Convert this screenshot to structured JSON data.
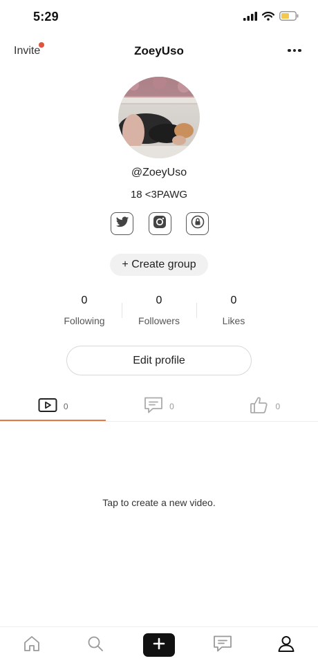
{
  "status_bar": {
    "time": "5:29",
    "icons": [
      "cellular-signal-icon",
      "wifi-icon",
      "battery-icon"
    ],
    "battery_color": "#f2c94c"
  },
  "header": {
    "invite_label": "Invite",
    "invite_dot_color": "#e0543d",
    "title": "ZoeyUso",
    "more_icon": "more-horizontal-icon"
  },
  "profile": {
    "handle": "@ZoeyUso",
    "bio": "18 <3PAWG",
    "socials": [
      "twitter-icon",
      "instagram-icon",
      "lock-icon"
    ],
    "create_group_label": "+ Create group",
    "edit_profile_label": "Edit profile"
  },
  "stats": [
    {
      "value": "0",
      "label": "Following"
    },
    {
      "value": "0",
      "label": "Followers"
    },
    {
      "value": "0",
      "label": "Likes"
    }
  ],
  "tabs": [
    {
      "icon": "video-icon",
      "count": "0",
      "active": true
    },
    {
      "icon": "comment-icon",
      "count": "0",
      "active": false
    },
    {
      "icon": "thumbs-up-icon",
      "count": "0",
      "active": false
    }
  ],
  "accent_color": "#e07a45",
  "empty_message": "Tap to create a new video.",
  "bottom_nav": [
    "home-icon",
    "search-icon",
    "add-icon",
    "messages-icon",
    "profile-icon"
  ]
}
